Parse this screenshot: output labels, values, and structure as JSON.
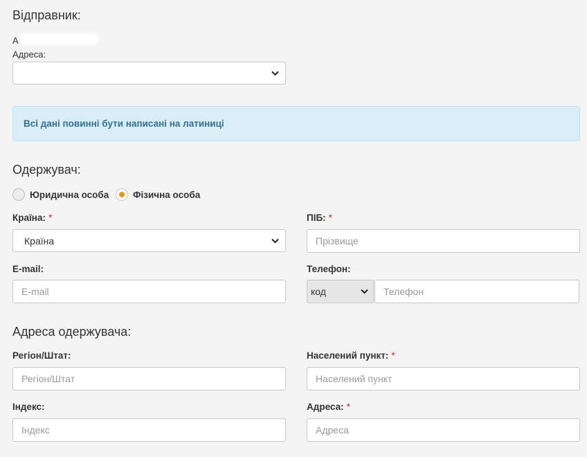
{
  "sender": {
    "heading": "Відправник:",
    "name_prefix": "A",
    "address_label": "Адреса:",
    "address_value": ""
  },
  "alert": {
    "text": "Всі дані повинні бути написані на латиниці",
    "color": "#31708f",
    "bg": "#d9edf7"
  },
  "recipient": {
    "heading": "Одержувач:",
    "radio_options": [
      {
        "label": "Юридична особа",
        "checked": false
      },
      {
        "label": "Фізична особа",
        "checked": true
      }
    ],
    "country": {
      "label": "Країна:",
      "required_mark": "*",
      "selected": "Країна"
    },
    "full_name": {
      "label": "ПІБ:",
      "required_mark": "*",
      "placeholder": "Прізвище"
    },
    "email": {
      "label": "E-mail:",
      "placeholder": "E-mail"
    },
    "phone": {
      "label": "Телефон:",
      "code_selected": "код",
      "placeholder": "Телефон"
    }
  },
  "recipient_address": {
    "heading": "Адреса одержувача:",
    "region": {
      "label": "Регіон/Штат:",
      "placeholder": "Регіон/Штат"
    },
    "city": {
      "label": "Населений пункт:",
      "required_mark": "*",
      "placeholder": "Населений пункт"
    },
    "postcode": {
      "label": "Індекс:",
      "placeholder": "Індекс"
    },
    "address": {
      "label": "Адреса:",
      "required_mark": "*",
      "placeholder": "Адреса"
    }
  },
  "colors": {
    "accent": "#f0940a",
    "required": "#e02020"
  }
}
